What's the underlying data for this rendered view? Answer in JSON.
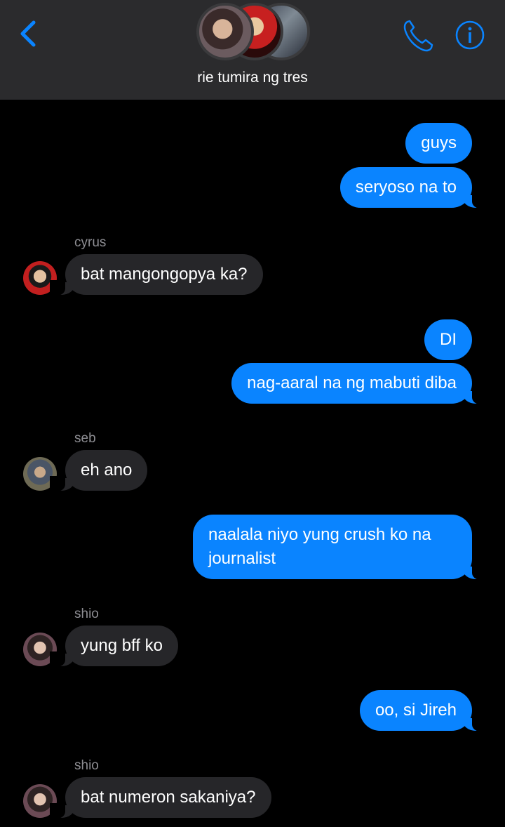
{
  "header": {
    "back_icon": "chevron-left-icon",
    "call_icon": "phone-icon",
    "info_icon": "info-icon",
    "group_name": "rie tumira ng tres",
    "accent_color": "#0a84ff"
  },
  "messages": [
    {
      "direction": "out",
      "text": "guys"
    },
    {
      "direction": "out",
      "text": "seryoso na to"
    },
    {
      "direction": "in",
      "sender": "cyrus",
      "text": "bat mangongopya ka?"
    },
    {
      "direction": "out",
      "text": "DI"
    },
    {
      "direction": "out",
      "text": "nag-aaral na ng mabuti diba"
    },
    {
      "direction": "in",
      "sender": "seb",
      "text": "eh ano"
    },
    {
      "direction": "out",
      "text": "naalala niyo yung crush ko na journalist"
    },
    {
      "direction": "in",
      "sender": "shio",
      "text": "yung bff ko"
    },
    {
      "direction": "out",
      "text": "oo, si Jireh"
    },
    {
      "direction": "in",
      "sender": "shio",
      "text": "bat numeron sakaniya?"
    }
  ],
  "colors": {
    "outgoing_bubble": "#0a84ff",
    "incoming_bubble": "#262629",
    "background": "#000000",
    "header_background": "#2b2b2d"
  }
}
